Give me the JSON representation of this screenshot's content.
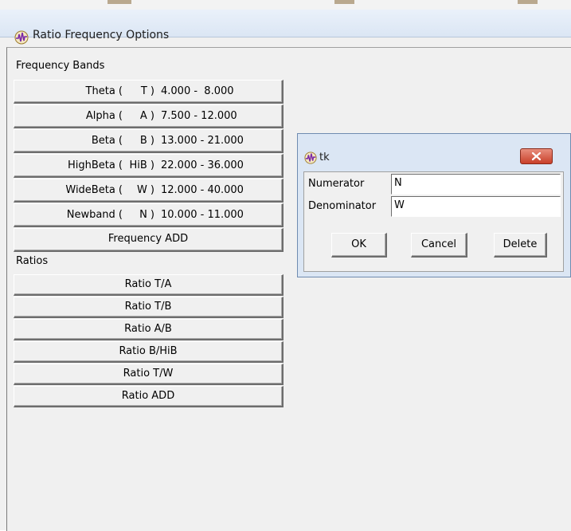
{
  "window": {
    "title": "Ratio Frequency Options"
  },
  "frequency_section": {
    "label": "Frequency Bands"
  },
  "bands": [
    {
      "name": "Theta (",
      "code": "T )",
      "range": "4.000 -  8.000"
    },
    {
      "name": "Alpha (",
      "code": "A )",
      "range": "7.500 - 12.000"
    },
    {
      "name": "Beta (",
      "code": "B )",
      "range": "13.000 - 21.000"
    },
    {
      "name": "HighBeta (",
      "code": "HiB )",
      "range": "22.000 - 36.000"
    },
    {
      "name": "WideBeta (",
      "code": "W )",
      "range": "12.000 - 40.000"
    },
    {
      "name": "Newband (",
      "code": "N )",
      "range": "10.000 - 11.000"
    }
  ],
  "frequency_add_label": "Frequency ADD",
  "ratios_section": {
    "label": "Ratios"
  },
  "ratios": [
    "Ratio T/A",
    "Ratio T/B",
    "Ratio A/B",
    "Ratio B/HiB",
    "Ratio T/W",
    "Ratio ADD"
  ],
  "dialog": {
    "title": "tk",
    "numerator_label": "Numerator",
    "numerator_value": "N",
    "denominator_label": "Denominator",
    "denominator_value": "W",
    "ok_label": "OK",
    "cancel_label": "Cancel",
    "delete_label": "Delete"
  },
  "icons": {
    "app": "app-waveform-icon",
    "close": "close-icon"
  },
  "colors": {
    "titlebar": "#dbe6f4",
    "close_button": "#c9402a",
    "face": "#f0f0f0"
  }
}
